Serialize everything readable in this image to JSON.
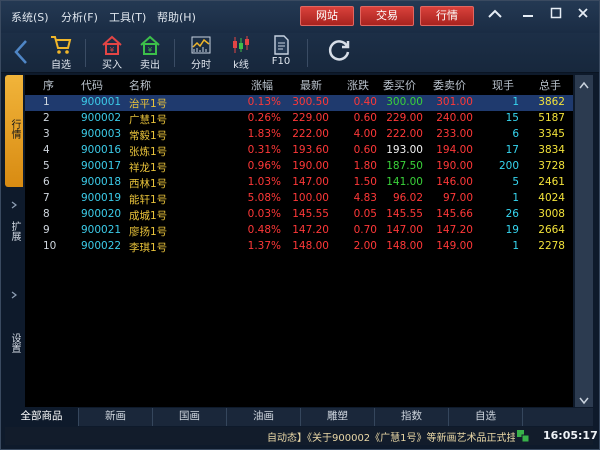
{
  "menu": {
    "items": [
      "系统(S)",
      "分析(F)",
      "工具(T)",
      "帮助(H)"
    ]
  },
  "top_buttons": [
    "网站",
    "交易",
    "行情"
  ],
  "toolbar": {
    "items": [
      {
        "label": "自选",
        "icon": "shopping-cart-icon"
      },
      {
        "label": "买入",
        "icon": "buy-house-icon"
      },
      {
        "label": "卖出",
        "icon": "sell-house-icon"
      },
      {
        "label": "分时",
        "icon": "timeshare-chart-icon"
      },
      {
        "label": "k线",
        "icon": "candlestick-icon"
      },
      {
        "label": "F10",
        "icon": "document-icon"
      }
    ]
  },
  "sidebar": {
    "tabs": [
      "行情",
      "扩展",
      "设置"
    ]
  },
  "table": {
    "headers": [
      "序",
      "代码",
      "名称",
      "涨幅",
      "最新",
      "涨跌",
      "委买价",
      "委卖价",
      "现手",
      "总手"
    ],
    "rows": [
      {
        "idx": "1",
        "code": "900001",
        "name": "治平1号",
        "pct": "0.13%",
        "last": "300.50",
        "chg": "0.40",
        "bid": "300.00",
        "ask": "301.00",
        "vol": "1",
        "total": "3862",
        "bid_color": "green",
        "ask_color": "red"
      },
      {
        "idx": "2",
        "code": "900002",
        "name": "广慧1号",
        "pct": "0.26%",
        "last": "229.00",
        "chg": "0.60",
        "bid": "229.00",
        "ask": "240.00",
        "vol": "15",
        "total": "5187",
        "bid_color": "red",
        "ask_color": "red"
      },
      {
        "idx": "3",
        "code": "900003",
        "name": "常毅1号",
        "pct": "1.83%",
        "last": "222.00",
        "chg": "4.00",
        "bid": "222.00",
        "ask": "233.00",
        "vol": "6",
        "total": "3345",
        "bid_color": "red",
        "ask_color": "red"
      },
      {
        "idx": "4",
        "code": "900016",
        "name": "张炼1号",
        "pct": "0.31%",
        "last": "193.60",
        "chg": "0.60",
        "bid": "193.00",
        "ask": "194.00",
        "vol": "17",
        "total": "3834",
        "bid_color": "white",
        "ask_color": "red"
      },
      {
        "idx": "5",
        "code": "900017",
        "name": "祥龙1号",
        "pct": "0.96%",
        "last": "190.00",
        "chg": "1.80",
        "bid": "187.50",
        "ask": "190.00",
        "vol": "200",
        "total": "3728",
        "bid_color": "green",
        "ask_color": "red"
      },
      {
        "idx": "6",
        "code": "900018",
        "name": "西林1号",
        "pct": "1.03%",
        "last": "147.00",
        "chg": "1.50",
        "bid": "141.00",
        "ask": "146.00",
        "vol": "5",
        "total": "2461",
        "bid_color": "green",
        "ask_color": "red"
      },
      {
        "idx": "7",
        "code": "900019",
        "name": "能轩1号",
        "pct": "5.08%",
        "last": "100.00",
        "chg": "4.83",
        "bid": "96.02",
        "ask": "97.00",
        "vol": "1",
        "total": "4024",
        "bid_color": "red",
        "ask_color": "red"
      },
      {
        "idx": "8",
        "code": "900020",
        "name": "成城1号",
        "pct": "0.03%",
        "last": "145.55",
        "chg": "0.05",
        "bid": "145.55",
        "ask": "145.66",
        "vol": "26",
        "total": "3008",
        "bid_color": "red",
        "ask_color": "red"
      },
      {
        "idx": "9",
        "code": "900021",
        "name": "廖扬1号",
        "pct": "0.48%",
        "last": "147.20",
        "chg": "0.70",
        "bid": "147.00",
        "ask": "147.20",
        "vol": "19",
        "total": "2664",
        "bid_color": "red",
        "ask_color": "red"
      },
      {
        "idx": "10",
        "code": "900022",
        "name": "李琪1号",
        "pct": "1.37%",
        "last": "148.00",
        "chg": "2.00",
        "bid": "148.00",
        "ask": "149.00",
        "vol": "1",
        "total": "2278",
        "bid_color": "red",
        "ask_color": "red"
      }
    ]
  },
  "bottom_tabs": [
    "全部商品",
    "新画",
    "国画",
    "油画",
    "雕塑",
    "指数",
    "自选"
  ],
  "status": {
    "ticker": "自动态】《关于900002《广慧1号》等新画艺术品正式挂牌交易",
    "clock": "16:05:17"
  },
  "colors": {
    "red": "#ff3838",
    "green": "#3ad23a",
    "white": "#f2f2f2",
    "selected_row": "#1f3a6e",
    "accent_button": "#c8302b"
  }
}
